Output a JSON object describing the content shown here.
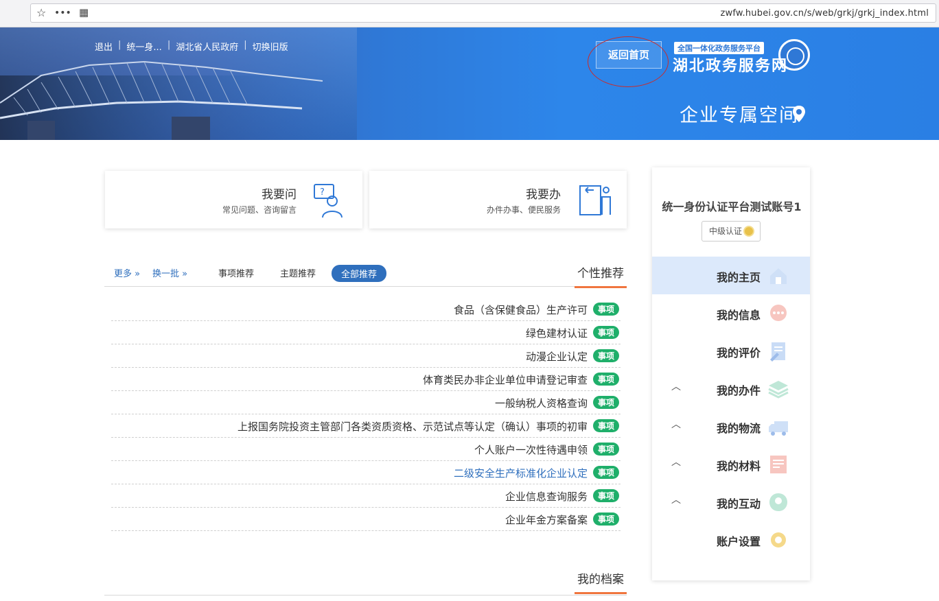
{
  "browser": {
    "url": "zwfw.hubei.gov.cn/s/web/grkj/grkj_index.html",
    "more_icon": "ellipsis-icon",
    "qr_icon": "qr-icon",
    "star_icon": "star-icon"
  },
  "header": {
    "links": [
      "切换旧版",
      "湖北省人民政府",
      "统一身...",
      "退出"
    ],
    "return_home": "返回首页",
    "logo_sub": "全国一体化政务服务平台",
    "logo_title": "湖北政务服务网",
    "space_title": "企业专属空间",
    "accent": "#2f78d6"
  },
  "cards": [
    {
      "title": "我要办",
      "sub": "办件办事、便民服务",
      "icon": "document-person-icon"
    },
    {
      "title": "我要问",
      "sub": "常见问题、咨询留言",
      "icon": "question-person-icon"
    }
  ],
  "recommend": {
    "title": "个性推荐",
    "tabs": [
      "全部推荐",
      "主题推荐",
      "事项推荐"
    ],
    "swap": "换一批",
    "more": "更多",
    "badge": "事项",
    "items": [
      "食品（含保健食品）生产许可",
      "绿色建材认证",
      "动漫企业认定",
      "体育类民办非企业单位申请登记审查",
      "一般纳税人资格查询",
      "上报国务院投资主管部门各类资质资格、示范试点等认定（确认）事项的初审",
      "个人账户一次性待遇申领",
      "二级安全生产标准化企业认定",
      "企业信息查询服务",
      "企业年金方案备案"
    ],
    "highlight_index": 7
  },
  "archive": {
    "title": "我的档案"
  },
  "sidebar": {
    "user": "统一身份认证平台测试账号1",
    "auth": "中级认证",
    "items": [
      {
        "label": "我的主页",
        "icon": "home-icon",
        "chevron": false
      },
      {
        "label": "我的信息",
        "icon": "chat-icon",
        "chevron": false
      },
      {
        "label": "我的评价",
        "icon": "edit-icon",
        "chevron": false
      },
      {
        "label": "我的办件",
        "icon": "layers-icon",
        "chevron": true
      },
      {
        "label": "我的物流",
        "icon": "truck-icon",
        "chevron": true
      },
      {
        "label": "我的材料",
        "icon": "file-icon",
        "chevron": true
      },
      {
        "label": "我的互动",
        "icon": "interact-icon",
        "chevron": true
      },
      {
        "label": "账户设置",
        "icon": "gear-icon",
        "chevron": false
      }
    ]
  }
}
